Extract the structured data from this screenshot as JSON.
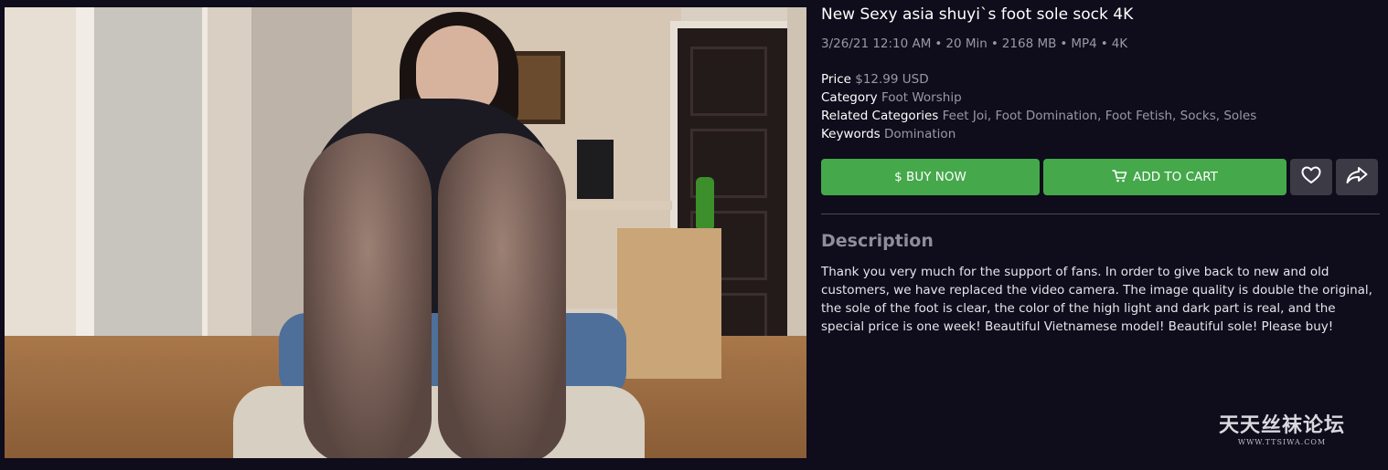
{
  "product": {
    "title": "New Sexy asia shuyi`s foot sole sock 4K",
    "meta": {
      "date": "3/26/21 12:10 AM",
      "duration": "20 Min",
      "size": "2168 MB",
      "format": "MP4",
      "resolution": "4K",
      "separator": "•"
    },
    "details": {
      "price_label": "Price",
      "price_value": "$12.99 USD",
      "category_label": "Category",
      "category_value": "Foot Worship",
      "related_label": "Related Categories",
      "related_values": [
        "Feet Joi",
        "Foot Domination",
        "Foot Fetish",
        "Socks",
        "Soles"
      ],
      "keywords_label": "Keywords",
      "keywords_value": "Domination"
    }
  },
  "actions": {
    "buy_now_label": "$ BUY NOW",
    "add_to_cart_label": "ADD TO CART",
    "add_to_cart_icon": "cart-icon",
    "favorite_icon": "heart-icon",
    "share_icon": "share-icon"
  },
  "description": {
    "heading": "Description",
    "body": "Thank you very much for the support of fans. In order to give back to new and old customers, we have replaced the video camera. The image quality is double the original, the sole of the foot is clear, the color of the high light and dark part is real, and the special price is one week! Beautiful Vietnamese model! Beautiful sole! Please buy!"
  },
  "watermark": {
    "main": "天天丝袜论坛",
    "sub": "WWW.TTSIWA.COM"
  },
  "colors": {
    "background": "#0f0c1b",
    "accent_green": "#45a84b",
    "icon_button": "#3b3a45",
    "muted_text": "#9a98a6"
  }
}
